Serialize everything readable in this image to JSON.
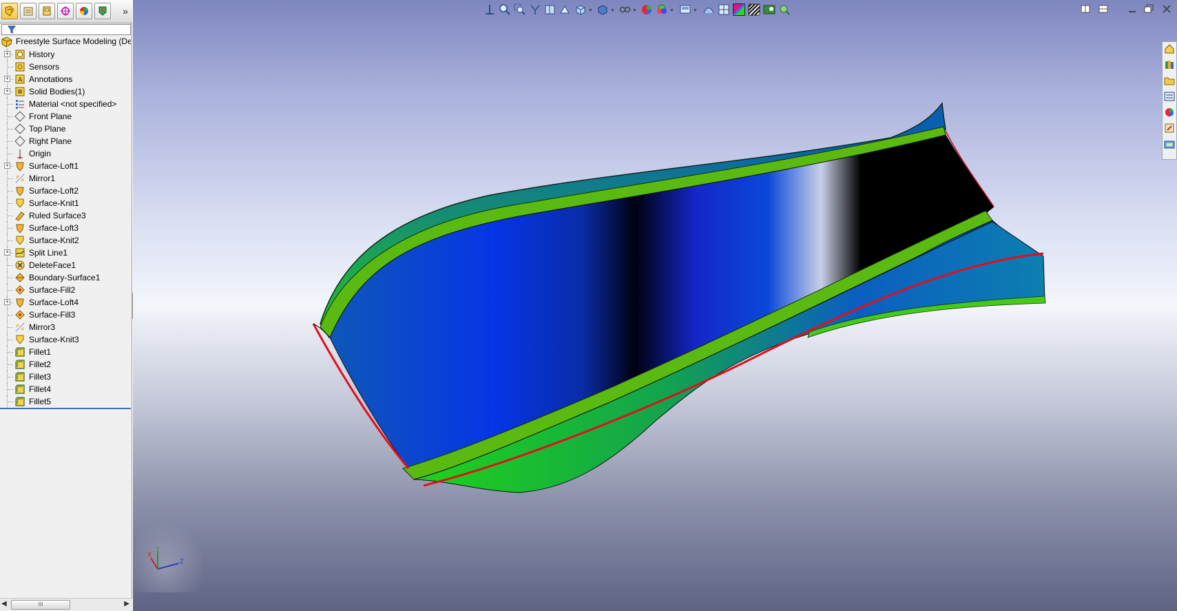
{
  "feature_tree": {
    "root_label": "Freestyle Surface Modeling  (Def",
    "items": [
      {
        "label": "History",
        "icon": "history-icon",
        "expandable": true
      },
      {
        "label": "Sensors",
        "icon": "sensors-icon",
        "expandable": false
      },
      {
        "label": "Annotations",
        "icon": "annotations-icon",
        "expandable": true
      },
      {
        "label": "Solid Bodies(1)",
        "icon": "solid-bodies-icon",
        "expandable": true
      },
      {
        "label": "Material <not specified>",
        "icon": "material-icon",
        "expandable": false
      },
      {
        "label": "Front Plane",
        "icon": "plane-icon",
        "expandable": false
      },
      {
        "label": "Top Plane",
        "icon": "plane-icon",
        "expandable": false
      },
      {
        "label": "Right Plane",
        "icon": "plane-icon",
        "expandable": false
      },
      {
        "label": "Origin",
        "icon": "origin-icon",
        "expandable": false
      },
      {
        "label": "Surface-Loft1",
        "icon": "surface-loft-icon",
        "expandable": true
      },
      {
        "label": "Mirror1",
        "icon": "mirror-icon",
        "expandable": false
      },
      {
        "label": "Surface-Loft2",
        "icon": "surface-loft-icon",
        "expandable": false
      },
      {
        "label": "Surface-Knit1",
        "icon": "surface-knit-icon",
        "expandable": false
      },
      {
        "label": "Ruled Surface3",
        "icon": "ruled-surface-icon",
        "expandable": false
      },
      {
        "label": "Surface-Loft3",
        "icon": "surface-loft-icon",
        "expandable": false
      },
      {
        "label": "Surface-Knit2",
        "icon": "surface-knit-icon",
        "expandable": false
      },
      {
        "label": "Split Line1",
        "icon": "split-line-icon",
        "expandable": true
      },
      {
        "label": "DeleteFace1",
        "icon": "delete-face-icon",
        "expandable": false
      },
      {
        "label": "Boundary-Surface1",
        "icon": "boundary-surface-icon",
        "expandable": false
      },
      {
        "label": "Surface-Fill2",
        "icon": "surface-fill-icon",
        "expandable": false
      },
      {
        "label": "Surface-Loft4",
        "icon": "surface-loft-icon",
        "expandable": true
      },
      {
        "label": "Surface-Fill3",
        "icon": "surface-fill-icon",
        "expandable": false
      },
      {
        "label": "Mirror3",
        "icon": "mirror-icon",
        "expandable": false
      },
      {
        "label": "Surface-Knit3",
        "icon": "surface-knit-icon",
        "expandable": false
      },
      {
        "label": "Fillet1",
        "icon": "fillet-icon",
        "expandable": false
      },
      {
        "label": "Fillet2",
        "icon": "fillet-icon",
        "expandable": false
      },
      {
        "label": "Fillet3",
        "icon": "fillet-icon",
        "expandable": false
      },
      {
        "label": "Fillet4",
        "icon": "fillet-icon",
        "expandable": false
      },
      {
        "label": "Fillet5",
        "icon": "fillet-icon",
        "expandable": false
      }
    ]
  },
  "panel_tabs": [
    "feature-manager-icon",
    "property-manager-icon",
    "configuration-manager-icon",
    "dimxpert-manager-icon",
    "display-manager-icon",
    "cam-manager-icon"
  ],
  "scrollbar": {
    "thumb_glyph": "III"
  },
  "colors": {
    "surface_blue": "#0a3ad8",
    "surface_green": "#5fbf10",
    "edge_red": "#e0101a",
    "panel_bg": "#f0f0f0",
    "rollback_bar": "#3f6fb8"
  },
  "triad": {
    "x_label": "X",
    "y_label": "Y",
    "z_label": "Z"
  }
}
